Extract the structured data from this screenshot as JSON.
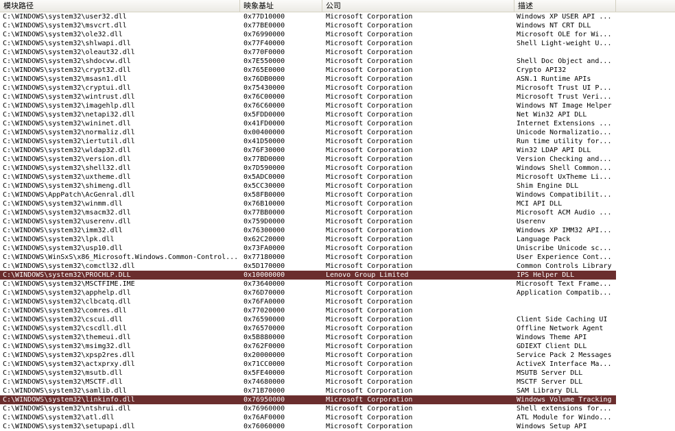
{
  "columns": {
    "path": "模块路径",
    "base": "映象基址",
    "company": "公司",
    "description": "描述"
  },
  "selected_rows": [
    29,
    43
  ],
  "colors": {
    "selection": "#6b2e2e",
    "header_bg": "#ebeae4"
  },
  "rows": [
    {
      "path": "C:\\WINDOWS\\system32\\user32.dll",
      "base": "0x77D10000",
      "company": "Microsoft Corporation",
      "description": "Windows XP USER API ..."
    },
    {
      "path": "C:\\WINDOWS\\system32\\msvcrt.dll",
      "base": "0x77BE0000",
      "company": "Microsoft Corporation",
      "description": "Windows NT CRT DLL"
    },
    {
      "path": "C:\\WINDOWS\\system32\\ole32.dll",
      "base": "0x76990000",
      "company": "Microsoft Corporation",
      "description": "Microsoft OLE for Wi..."
    },
    {
      "path": "C:\\WINDOWS\\system32\\shlwapi.dll",
      "base": "0x77F40000",
      "company": "Microsoft Corporation",
      "description": "Shell Light-weight U..."
    },
    {
      "path": "C:\\WINDOWS\\system32\\oleaut32.dll",
      "base": "0x770F0000",
      "company": "Microsoft Corporation",
      "description": ""
    },
    {
      "path": "C:\\WINDOWS\\system32\\shdocvw.dll",
      "base": "0x7E550000",
      "company": "Microsoft Corporation",
      "description": "Shell Doc Object and..."
    },
    {
      "path": "C:\\WINDOWS\\system32\\crypt32.dll",
      "base": "0x765E0000",
      "company": "Microsoft Corporation",
      "description": "Crypto API32"
    },
    {
      "path": "C:\\WINDOWS\\system32\\msasn1.dll",
      "base": "0x76DB0000",
      "company": "Microsoft Corporation",
      "description": "ASN.1 Runtime APIs"
    },
    {
      "path": "C:\\WINDOWS\\system32\\cryptui.dll",
      "base": "0x75430000",
      "company": "Microsoft Corporation",
      "description": "Microsoft Trust UI P..."
    },
    {
      "path": "C:\\WINDOWS\\system32\\wintrust.dll",
      "base": "0x76C00000",
      "company": "Microsoft Corporation",
      "description": "Microsoft Trust Veri..."
    },
    {
      "path": "C:\\WINDOWS\\system32\\imagehlp.dll",
      "base": "0x76C60000",
      "company": "Microsoft Corporation",
      "description": "Windows NT Image Helper"
    },
    {
      "path": "C:\\WINDOWS\\system32\\netapi32.dll",
      "base": "0x5FDD0000",
      "company": "Microsoft Corporation",
      "description": "Net Win32 API DLL"
    },
    {
      "path": "C:\\WINDOWS\\system32\\wininet.dll",
      "base": "0x41FD0000",
      "company": "Microsoft Corporation",
      "description": "Internet Extensions ..."
    },
    {
      "path": "C:\\WINDOWS\\system32\\normaliz.dll",
      "base": "0x00400000",
      "company": "Microsoft Corporation",
      "description": "Unicode Normalizatio..."
    },
    {
      "path": "C:\\WINDOWS\\system32\\iertutil.dll",
      "base": "0x41D50000",
      "company": "Microsoft Corporation",
      "description": "Run time utility for..."
    },
    {
      "path": "C:\\WINDOWS\\system32\\wldap32.dll",
      "base": "0x76F30000",
      "company": "Microsoft Corporation",
      "description": "Win32 LDAP API DLL"
    },
    {
      "path": "C:\\WINDOWS\\system32\\version.dll",
      "base": "0x77BD0000",
      "company": "Microsoft Corporation",
      "description": "Version Checking and..."
    },
    {
      "path": "C:\\WINDOWS\\system32\\shell32.dll",
      "base": "0x7D590000",
      "company": "Microsoft Corporation",
      "description": "Windows Shell Common..."
    },
    {
      "path": "C:\\WINDOWS\\system32\\uxtheme.dll",
      "base": "0x5ADC0000",
      "company": "Microsoft Corporation",
      "description": "Microsoft UxTheme Li..."
    },
    {
      "path": "C:\\WINDOWS\\system32\\shimeng.dll",
      "base": "0x5CC30000",
      "company": "Microsoft Corporation",
      "description": "Shim Engine DLL"
    },
    {
      "path": "C:\\WINDOWS\\AppPatch\\AcGenral.dll",
      "base": "0x58FB0000",
      "company": "Microsoft Corporation",
      "description": "Windows Compatibilit..."
    },
    {
      "path": "C:\\WINDOWS\\system32\\winmm.dll",
      "base": "0x76B10000",
      "company": "Microsoft Corporation",
      "description": "MCI API DLL"
    },
    {
      "path": "C:\\WINDOWS\\system32\\msacm32.dll",
      "base": "0x77BB0000",
      "company": "Microsoft Corporation",
      "description": "Microsoft ACM Audio ..."
    },
    {
      "path": "C:\\WINDOWS\\system32\\userenv.dll",
      "base": "0x759D0000",
      "company": "Microsoft Corporation",
      "description": "Userenv"
    },
    {
      "path": "C:\\WINDOWS\\system32\\imm32.dll",
      "base": "0x76300000",
      "company": "Microsoft Corporation",
      "description": "Windows XP IMM32 API..."
    },
    {
      "path": "C:\\WINDOWS\\system32\\lpk.dll",
      "base": "0x62C20000",
      "company": "Microsoft Corporation",
      "description": "Language Pack"
    },
    {
      "path": "C:\\WINDOWS\\system32\\usp10.dll",
      "base": "0x73FA0000",
      "company": "Microsoft Corporation",
      "description": "Uniscribe Unicode sc..."
    },
    {
      "path": "C:\\WINDOWS\\WinSxS\\x86_Microsoft.Windows.Common-Control...",
      "base": "0x77180000",
      "company": "Microsoft Corporation",
      "description": "User Experience Cont..."
    },
    {
      "path": "C:\\WINDOWS\\system32\\comctl32.dll",
      "base": "0x5D170000",
      "company": "Microsoft Corporation",
      "description": "Common Controls Library"
    },
    {
      "path": "C:\\WINDOWS\\system32\\PROCHLP.DLL",
      "base": "0x10000000",
      "company": "Lenovo Group Limited",
      "description": "IPS Helper DLL"
    },
    {
      "path": "C:\\WINDOWS\\system32\\MSCTFIME.IME",
      "base": "0x73640000",
      "company": "Microsoft Corporation",
      "description": "Microsoft Text Frame..."
    },
    {
      "path": "C:\\WINDOWS\\system32\\apphelp.dll",
      "base": "0x76D70000",
      "company": "Microsoft Corporation",
      "description": "Application Compatib..."
    },
    {
      "path": "C:\\WINDOWS\\system32\\clbcatq.dll",
      "base": "0x76FA0000",
      "company": "Microsoft Corporation",
      "description": ""
    },
    {
      "path": "C:\\WINDOWS\\system32\\comres.dll",
      "base": "0x77020000",
      "company": "Microsoft Corporation",
      "description": ""
    },
    {
      "path": "C:\\WINDOWS\\system32\\cscui.dll",
      "base": "0x76590000",
      "company": "Microsoft Corporation",
      "description": "Client Side Caching UI"
    },
    {
      "path": "C:\\WINDOWS\\system32\\cscdll.dll",
      "base": "0x76570000",
      "company": "Microsoft Corporation",
      "description": "Offline Network Agent"
    },
    {
      "path": "C:\\WINDOWS\\system32\\themeui.dll",
      "base": "0x5B880000",
      "company": "Microsoft Corporation",
      "description": "Windows Theme API"
    },
    {
      "path": "C:\\WINDOWS\\system32\\msimg32.dll",
      "base": "0x762F0000",
      "company": "Microsoft Corporation",
      "description": "GDIEXT Client DLL"
    },
    {
      "path": "C:\\WINDOWS\\system32\\xpsp2res.dll",
      "base": "0x20000000",
      "company": "Microsoft Corporation",
      "description": "Service Pack 2 Messages"
    },
    {
      "path": "C:\\WINDOWS\\system32\\actxprxy.dll",
      "base": "0x71CC0000",
      "company": "Microsoft Corporation",
      "description": "ActiveX Interface Ma..."
    },
    {
      "path": "C:\\WINDOWS\\system32\\msutb.dll",
      "base": "0x5FE40000",
      "company": "Microsoft Corporation",
      "description": "MSUTB Server DLL"
    },
    {
      "path": "C:\\WINDOWS\\system32\\MSCTF.dll",
      "base": "0x74680000",
      "company": "Microsoft Corporation",
      "description": "MSCTF Server DLL"
    },
    {
      "path": "C:\\WINDOWS\\system32\\samlib.dll",
      "base": "0x71B70000",
      "company": "Microsoft Corporation",
      "description": "SAM Library DLL"
    },
    {
      "path": "C:\\WINDOWS\\system32\\linkinfo.dll",
      "base": "0x76950000",
      "company": "Microsoft Corporation",
      "description": "Windows Volume Tracking"
    },
    {
      "path": "C:\\WINDOWS\\system32\\ntshrui.dll",
      "base": "0x76960000",
      "company": "Microsoft Corporation",
      "description": "Shell extensions for..."
    },
    {
      "path": "C:\\WINDOWS\\system32\\atl.dll",
      "base": "0x76AF0000",
      "company": "Microsoft Corporation",
      "description": "ATL Module for Windo..."
    },
    {
      "path": "C:\\WINDOWS\\system32\\setupapi.dll",
      "base": "0x76060000",
      "company": "Microsoft Corporation",
      "description": "Windows Setup API"
    }
  ]
}
